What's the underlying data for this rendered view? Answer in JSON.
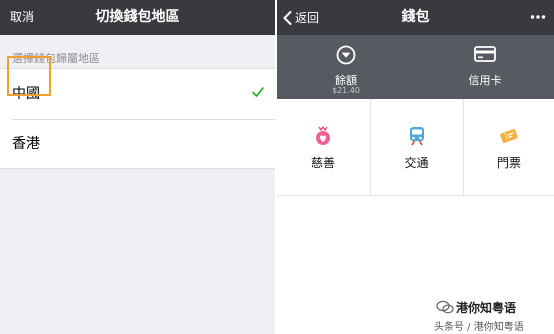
{
  "left": {
    "navbar": {
      "cancel": "取消",
      "title": "切換錢包地區"
    },
    "section_label": "選擇錢包歸屬地區",
    "regions": [
      {
        "label": "中國",
        "selected": true
      },
      {
        "label": "香港",
        "selected": false
      }
    ],
    "check_icon": "checkmark-icon",
    "accent_color": "#1aad19",
    "highlight_color": "#f0a030"
  },
  "right": {
    "navbar": {
      "back": "返回",
      "title": "錢包",
      "more_icon": "more-dots-icon"
    },
    "wallet_bar": {
      "balance_label": "餘額",
      "balance_value": "$21.40",
      "card_label": "信用卡"
    },
    "services": [
      {
        "label": "慈善",
        "icon": "charity-icon"
      },
      {
        "label": "交通",
        "icon": "transport-icon"
      },
      {
        "label": "門票",
        "icon": "ticket-icon"
      }
    ]
  },
  "watermark": {
    "title": "港你知粤语",
    "subtitle": "头条号 / 港你知粤语"
  }
}
